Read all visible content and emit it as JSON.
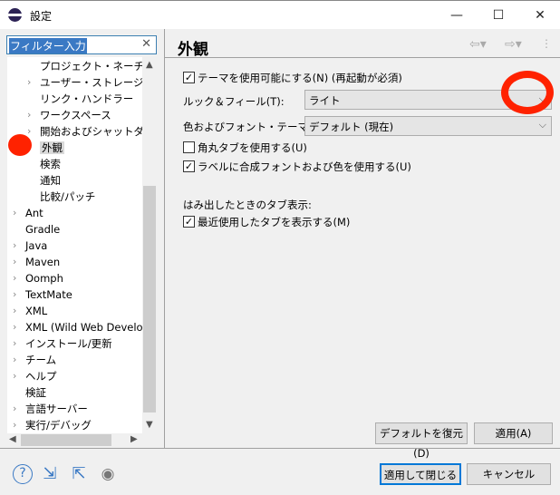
{
  "window": {
    "title": "設定",
    "minimize": "—",
    "maximize": "☐",
    "close": "✕"
  },
  "filter": {
    "value": "フィルター入力",
    "clear_icon": "close-icon"
  },
  "tree": {
    "items": [
      {
        "label": "プロジェクト・ネーチャー",
        "level": 1,
        "expandable": false
      },
      {
        "label": "ユーザー・ストレージ・サービス",
        "level": 1,
        "expandable": true
      },
      {
        "label": "リンク・ハンドラー",
        "level": 1,
        "expandable": false
      },
      {
        "label": "ワークスペース",
        "level": 1,
        "expandable": true
      },
      {
        "label": "開始およびシャットダウン",
        "level": 1,
        "expandable": true
      },
      {
        "label": "外観",
        "level": 1,
        "expandable": false,
        "selected": true
      },
      {
        "label": "検索",
        "level": 1,
        "expandable": false
      },
      {
        "label": "通知",
        "level": 1,
        "expandable": false
      },
      {
        "label": "比較/パッチ",
        "level": 1,
        "expandable": false
      },
      {
        "label": "Ant",
        "level": 0,
        "expandable": true
      },
      {
        "label": "Gradle",
        "level": 0,
        "expandable": false
      },
      {
        "label": "Java",
        "level": 0,
        "expandable": true
      },
      {
        "label": "Maven",
        "level": 0,
        "expandable": true
      },
      {
        "label": "Oomph",
        "level": 0,
        "expandable": true
      },
      {
        "label": "TextMate",
        "level": 0,
        "expandable": true
      },
      {
        "label": "XML",
        "level": 0,
        "expandable": true
      },
      {
        "label": "XML (Wild Web Developer)",
        "level": 0,
        "expandable": true
      },
      {
        "label": "インストール/更新",
        "level": 0,
        "expandable": true
      },
      {
        "label": "チーム",
        "level": 0,
        "expandable": true
      },
      {
        "label": "ヘルプ",
        "level": 0,
        "expandable": true
      },
      {
        "label": "検証",
        "level": 0,
        "expandable": false
      },
      {
        "label": "言語サーバー",
        "level": 0,
        "expandable": true
      },
      {
        "label": "実行/デバッグ",
        "level": 0,
        "expandable": true
      }
    ]
  },
  "page": {
    "title": "外観",
    "enable_theme": {
      "label": "テーマを使用可能にする(N) (再起動が必須)",
      "checked": true
    },
    "look_feel": {
      "label": "ルック＆フィール(T):",
      "value": "ライト"
    },
    "color_theme": {
      "label": "色およびフォント・テーマ(C):",
      "value": "デフォルト (現在)"
    },
    "round_tabs": {
      "label": "角丸タブを使用する(U)",
      "checked": false
    },
    "label_fonts": {
      "label": "ラベルに合成フォントおよび色を使用する(U)",
      "checked": true
    },
    "overflow_heading": "はみ出したときのタブ表示:",
    "recent_tabs": {
      "label": "最近使用したタブを表示する(M)",
      "checked": true
    },
    "restore_defaults": "デフォルトを復元(D)",
    "apply": "適用(A)"
  },
  "footer": {
    "apply_close": "適用して閉じる",
    "cancel": "キャンセル"
  },
  "annotation_color": "#ff2200"
}
